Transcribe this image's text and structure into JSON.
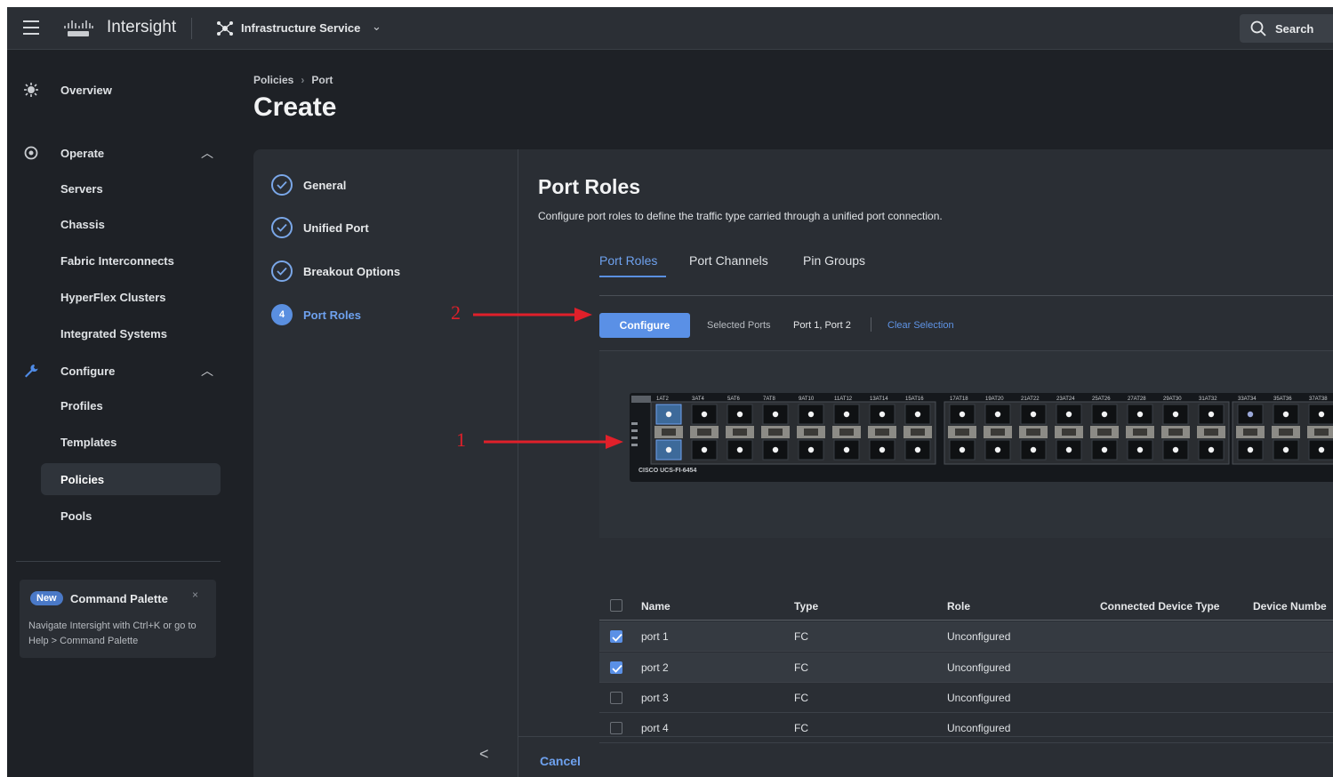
{
  "header": {
    "brand": "Intersight",
    "service": "Infrastructure Service",
    "search_label": "Search"
  },
  "sidebar": {
    "items": [
      {
        "label": "Overview"
      },
      {
        "label": "Operate"
      },
      {
        "label": "Servers"
      },
      {
        "label": "Chassis"
      },
      {
        "label": "Fabric Interconnects"
      },
      {
        "label": "HyperFlex Clusters"
      },
      {
        "label": "Integrated Systems"
      },
      {
        "label": "Configure"
      },
      {
        "label": "Profiles"
      },
      {
        "label": "Templates"
      },
      {
        "label": "Policies"
      },
      {
        "label": "Pools"
      }
    ],
    "palette": {
      "badge": "New",
      "title": "Command Palette",
      "close": "×",
      "desc": "Navigate Intersight with Ctrl+K or go to Help > Command Palette"
    }
  },
  "page": {
    "breadcrumb": [
      "Policies",
      "Port"
    ],
    "title": "Create"
  },
  "wizard": {
    "steps": [
      {
        "label": "General",
        "state": "done"
      },
      {
        "label": "Unified Port",
        "state": "done"
      },
      {
        "label": "Breakout Options",
        "state": "done"
      },
      {
        "label": "Port Roles",
        "state": "current",
        "number": "4"
      }
    ],
    "back": "<"
  },
  "content": {
    "title": "Port Roles",
    "description": "Configure port roles to define the traffic type carried through a unified port connection.",
    "tabs": [
      "Port Roles",
      "Port Channels",
      "Pin Groups"
    ],
    "configure_label": "Configure",
    "selected_ports_label": "Selected Ports",
    "selected_ports_value": "Port 1, Port 2",
    "clear_selection": "Clear Selection",
    "switch_model": "CISCO UCS-FI-6454",
    "switch_groups": [
      [
        "1AT2",
        "3AT4",
        "5AT6",
        "7AT8",
        "9AT10",
        "11AT12",
        "13AT14",
        "15AT16"
      ],
      [
        "17AT18",
        "19AT20",
        "21AT22",
        "23AT24",
        "25AT26",
        "27AT28",
        "29AT30",
        "31AT32"
      ],
      [
        "33AT34",
        "35AT36",
        "37AT38"
      ]
    ],
    "table": {
      "columns": [
        "Name",
        "Type",
        "Role",
        "Connected Device Type",
        "Device Numbe"
      ],
      "rows": [
        {
          "name": "port 1",
          "type": "FC",
          "role": "Unconfigured",
          "checked": true
        },
        {
          "name": "port 2",
          "type": "FC",
          "role": "Unconfigured",
          "checked": true
        },
        {
          "name": "port 3",
          "type": "FC",
          "role": "Unconfigured",
          "checked": false
        },
        {
          "name": "port 4",
          "type": "FC",
          "role": "Unconfigured",
          "checked": false
        }
      ]
    },
    "cancel_label": "Cancel"
  },
  "annotations": [
    "1",
    "2"
  ],
  "colors": {
    "accent": "#5a90e6",
    "annotation": "#e0202a",
    "background": "#1e2126",
    "panel": "#2a2e34"
  }
}
